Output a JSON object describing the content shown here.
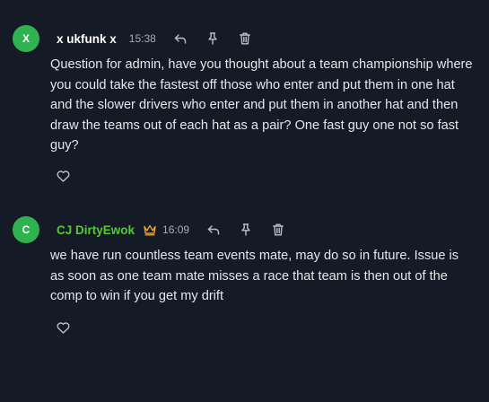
{
  "colors": {
    "background": "#141a26",
    "avatar": "#2fb350",
    "admin_name": "#55c934",
    "crown": "#f0a020",
    "icon": "#b9bfca"
  },
  "messages": [
    {
      "avatar_letter": "X",
      "author": "x ukfunk x",
      "time": "15:38",
      "text": "Question for admin, have you thought about a team championship where you could take the fastest off those who enter and put them in one hat and the slower drivers who enter and put them in another hat and then draw the teams out of each hat as a pair? One fast guy one not so fast guy?",
      "actions": [
        "reply-icon",
        "pin-icon",
        "trash-icon"
      ],
      "reaction_icon": "heart-icon"
    },
    {
      "avatar_letter": "C",
      "author": "CJ DirtyEwok",
      "author_badge_icon": "crown-icon",
      "time": "16:09",
      "text": "we have run countless team events mate, may do so in future. Issue is as soon as one team mate misses a race that team is then out of the comp to win if you get my drift",
      "actions": [
        "reply-icon",
        "pin-icon",
        "trash-icon"
      ],
      "reaction_icon": "heart-icon"
    }
  ]
}
